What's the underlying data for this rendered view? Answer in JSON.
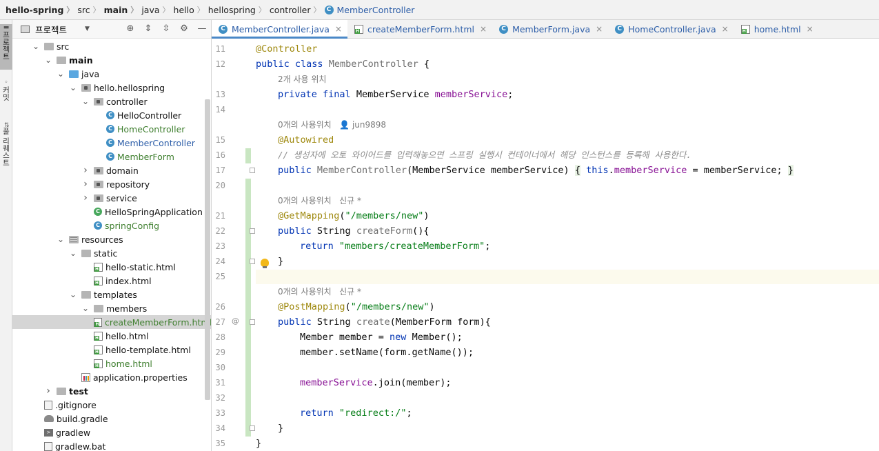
{
  "breadcrumb": {
    "items": [
      "hello-spring",
      "src",
      "main",
      "java",
      "hello",
      "hellospring",
      "controller"
    ],
    "current": "MemberController",
    "current_icon": "C"
  },
  "toolstrip": {
    "project": "프로젝트",
    "commit": "커밋",
    "structure": "풀 리퀘스트"
  },
  "project_panel": {
    "title": "프로젝트",
    "tools": [
      "crosshair-icon",
      "expand-all-icon",
      "collapse-all-icon",
      "gear-icon",
      "minimize-icon"
    ],
    "tree": [
      {
        "label": "src",
        "arrow": "open",
        "icon": "folder"
      },
      {
        "label": "main",
        "arrow": "open",
        "icon": "folder",
        "bold": true
      },
      {
        "label": "java",
        "arrow": "open",
        "icon": "folder-blue"
      },
      {
        "label": "hello.hellospring",
        "arrow": "open",
        "icon": "package"
      },
      {
        "label": "controller",
        "arrow": "open",
        "icon": "package"
      },
      {
        "label": "HelloController",
        "icon": "class"
      },
      {
        "label": "HomeController",
        "icon": "class",
        "color": "green"
      },
      {
        "label": "MemberController",
        "icon": "class",
        "color": "blue"
      },
      {
        "label": "MemberForm",
        "icon": "class",
        "color": "green"
      },
      {
        "label": "domain",
        "arrow": "closed",
        "icon": "package"
      },
      {
        "label": "repository",
        "arrow": "closed",
        "icon": "package"
      },
      {
        "label": "service",
        "arrow": "closed",
        "icon": "package"
      },
      {
        "label": "HelloSpringApplication",
        "icon": "class-run"
      },
      {
        "label": "springConfig",
        "icon": "class",
        "color": "green"
      },
      {
        "label": "resources",
        "arrow": "open",
        "icon": "resources"
      },
      {
        "label": "static",
        "arrow": "open",
        "icon": "folder"
      },
      {
        "label": "hello-static.html",
        "icon": "html"
      },
      {
        "label": "index.html",
        "icon": "html"
      },
      {
        "label": "templates",
        "arrow": "open",
        "icon": "folder"
      },
      {
        "label": "members",
        "arrow": "open",
        "icon": "folder"
      },
      {
        "label": "createMemberForm.html",
        "icon": "html",
        "color": "green",
        "selected": true
      },
      {
        "label": "hello.html",
        "icon": "html"
      },
      {
        "label": "hello-template.html",
        "icon": "html"
      },
      {
        "label": "home.html",
        "icon": "html",
        "color": "green"
      },
      {
        "label": "application.properties",
        "icon": "properties"
      },
      {
        "label": "test",
        "arrow": "closed",
        "icon": "folder",
        "bold": true
      },
      {
        "label": ".gitignore",
        "icon": "file"
      },
      {
        "label": "build.gradle",
        "icon": "gradle"
      },
      {
        "label": "gradlew",
        "icon": "terminal"
      },
      {
        "label": "gradlew.bat",
        "icon": "file"
      }
    ]
  },
  "tabs": [
    {
      "label": "MemberController.java",
      "icon": "class",
      "active": true
    },
    {
      "label": "createMemberForm.html",
      "icon": "html"
    },
    {
      "label": "MemberForm.java",
      "icon": "class"
    },
    {
      "label": "HomeController.java",
      "icon": "class"
    },
    {
      "label": "home.html",
      "icon": "html"
    }
  ],
  "editor": {
    "line_numbers": [
      "11",
      "12",
      "13",
      "14",
      "15",
      "16",
      "17",
      "20",
      "21",
      "22",
      "23",
      "24",
      "25",
      "26",
      "27",
      "28",
      "29",
      "30",
      "31",
      "32",
      "33",
      "34",
      "35"
    ],
    "hints": {
      "usage_2": "2개 사용 위치",
      "usage_0_author": "0개의 사용위치",
      "author": "jun9898",
      "usage_0_new_a": "0개의 사용위치   신규 *",
      "usage_0_new_b": "0개의 사용위치   신규 *"
    },
    "code": {
      "l11_ann": "@Controller",
      "l12_public": "public",
      "l12_class": "class",
      "l12_name": "MemberController",
      "l12_brace": "{",
      "l13_mods": "private final",
      "l13_type": "MemberService",
      "l13_field": "memberService",
      "l13_end": ";",
      "l15_ann": "@Autowired",
      "l16_comment": "// 생성자에 오토 와이어드를 입력해놓으면 스프링 실행시 컨테이너에서 해당 인스턴스를 등록해 사용한다.",
      "l17_public": "public",
      "l17_ctor": "MemberController",
      "l17_params": "(MemberService memberService)",
      "l17_open": "{",
      "l17_this": "this",
      "l17_dot": ".",
      "l17_field": "memberService",
      "l17_assign": " = memberService;",
      "l17_close": "}",
      "l21_ann": "@GetMapping",
      "l21_open": "(",
      "l21_str": "\"/members/new\"",
      "l21_close": ")",
      "l22_public": "public",
      "l22_type": "String",
      "l22_method": "createForm",
      "l22_rest": "(){",
      "l23_return": "return",
      "l23_str": "\"members/createMemberForm\"",
      "l23_end": ";",
      "l24_brace": "}",
      "l26_ann": "@PostMapping",
      "l26_open": "(",
      "l26_str": "\"/members/new\"",
      "l26_close": ")",
      "l27_public": "public",
      "l27_type": "String",
      "l27_method": "create",
      "l27_rest": "(MemberForm form){",
      "l28_a": "Member member = ",
      "l28_new": "new",
      "l28_b": " Member();",
      "l29": "member.setName(form.getName());",
      "l31_field": "memberService",
      "l31_rest": ".join(member);",
      "l33_return": "return",
      "l33_str": "\"redirect:/\"",
      "l33_end": ";",
      "l34_brace": "}",
      "l35_brace": "}"
    }
  }
}
